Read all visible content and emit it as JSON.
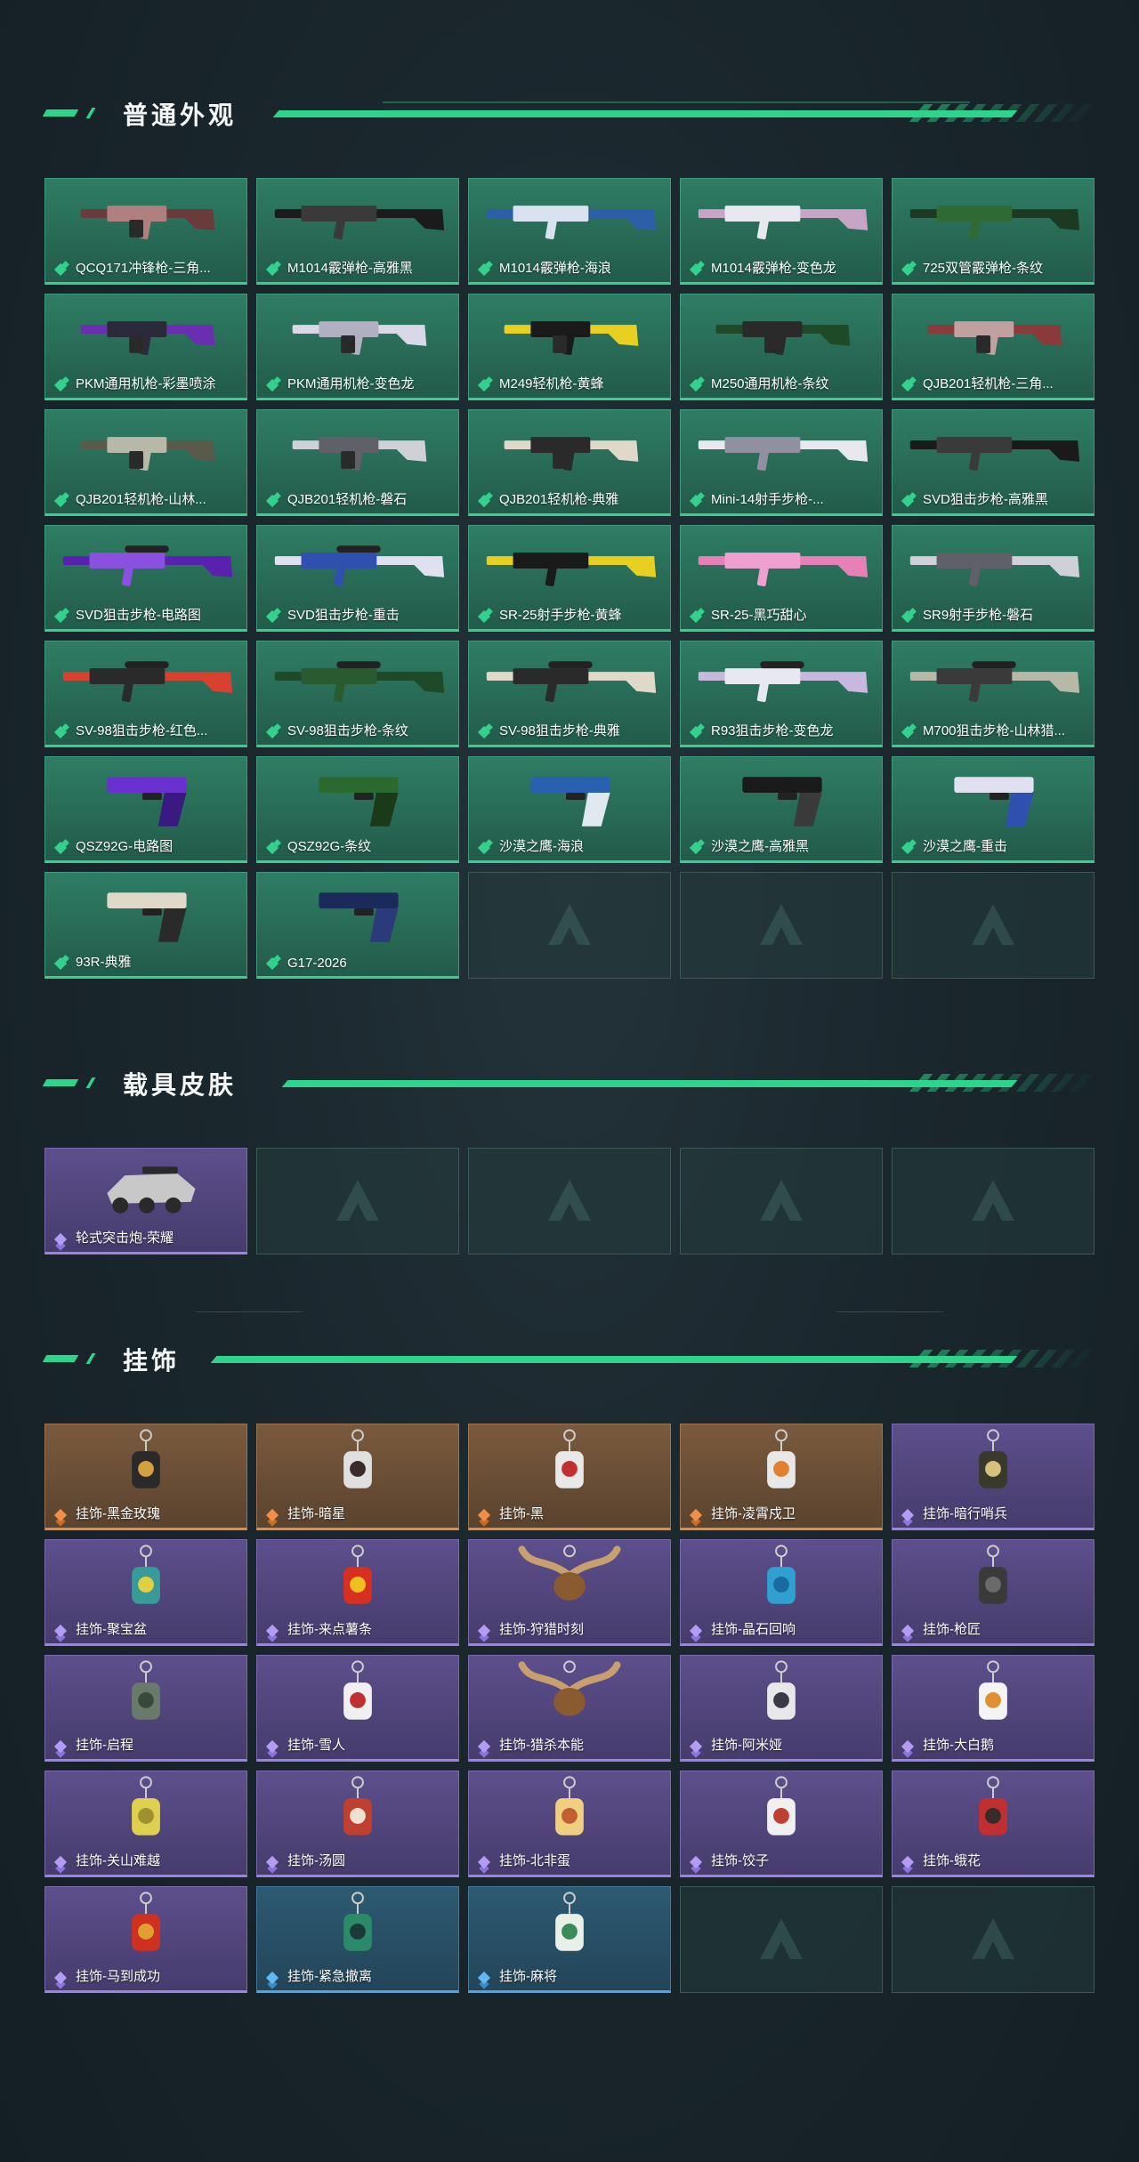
{
  "sections": {
    "appearance": {
      "title": "普通外观",
      "items": [
        {
          "label": "QCQ171冲锋枪-三角...",
          "rarity": "green",
          "icon": "smg-icon",
          "c1": "#6b3a3a",
          "c2": "#b08080"
        },
        {
          "label": "M1014霰弹枪-高雅黑",
          "rarity": "green",
          "icon": "shotgun-icon",
          "c1": "#1b1b1b",
          "c2": "#3a3a3a"
        },
        {
          "label": "M1014霰弹枪-海浪",
          "rarity": "green",
          "icon": "shotgun-icon",
          "c1": "#2c5fa8",
          "c2": "#d8e2f0"
        },
        {
          "label": "M1014霰弹枪-变色龙",
          "rarity": "green",
          "icon": "shotgun-icon",
          "c1": "#c8a5c6",
          "c2": "#e8e8f0"
        },
        {
          "label": "725双管霰弹枪-条纹",
          "rarity": "green",
          "icon": "shotgun-icon",
          "c1": "#1c3a22",
          "c2": "#2f6a35"
        },
        {
          "label": "PKM通用机枪-彩墨喷涂",
          "rarity": "green",
          "icon": "lmg-icon",
          "c1": "#6a2fb0",
          "c2": "#2a2a3a"
        },
        {
          "label": "PKM通用机枪-变色龙",
          "rarity": "green",
          "icon": "lmg-icon",
          "c1": "#d8d8e8",
          "c2": "#b0b0c0"
        },
        {
          "label": "M249轻机枪-黄蜂",
          "rarity": "green",
          "icon": "lmg-icon",
          "c1": "#e8d020",
          "c2": "#1a1a1a"
        },
        {
          "label": "M250通用机枪-条纹",
          "rarity": "green",
          "icon": "lmg-icon",
          "c1": "#1f4a28",
          "c2": "#2a2a2a"
        },
        {
          "label": "QJB201轻机枪-三角...",
          "rarity": "green",
          "icon": "lmg-icon",
          "c1": "#8a3a3a",
          "c2": "#c0a0a0"
        },
        {
          "label": "QJB201轻机枪-山林...",
          "rarity": "green",
          "icon": "lmg-icon",
          "c1": "#5a5a4a",
          "c2": "#b8b8a8"
        },
        {
          "label": "QJB201轻机枪-磐石",
          "rarity": "green",
          "icon": "lmg-icon",
          "c1": "#d0d0d8",
          "c2": "#606068"
        },
        {
          "label": "QJB201轻机枪-典雅",
          "rarity": "green",
          "icon": "lmg-icon",
          "c1": "#e0d8c8",
          "c2": "#2a2a2a"
        },
        {
          "label": "Mini-14射手步枪-...",
          "rarity": "green",
          "icon": "rifle-icon",
          "c1": "#e8e8f0",
          "c2": "#9090a0"
        },
        {
          "label": "SVD狙击步枪-高雅黑",
          "rarity": "green",
          "icon": "rifle-icon",
          "c1": "#1a1a1a",
          "c2": "#3a3a3a"
        },
        {
          "label": "SVD狙击步枪-电路图",
          "rarity": "green",
          "icon": "sniper-icon",
          "c1": "#5a20b0",
          "c2": "#8a50e0"
        },
        {
          "label": "SVD狙击步枪-重击",
          "rarity": "green",
          "icon": "sniper-icon",
          "c1": "#e0e0f0",
          "c2": "#3050b0"
        },
        {
          "label": "SR-25射手步枪-黄蜂",
          "rarity": "green",
          "icon": "rifle-icon",
          "c1": "#e8d020",
          "c2": "#1a1a1a"
        },
        {
          "label": "SR-25-黑巧甜心",
          "rarity": "green",
          "icon": "rifle-icon",
          "c1": "#e880b8",
          "c2": "#f0a0d0"
        },
        {
          "label": "SR9射手步枪-磐石",
          "rarity": "green",
          "icon": "rifle-icon",
          "c1": "#d0d0d8",
          "c2": "#606068"
        },
        {
          "label": "SV-98狙击步枪-红色...",
          "rarity": "green",
          "icon": "sniper-icon",
          "c1": "#d84030",
          "c2": "#2a2a2a"
        },
        {
          "label": "SV-98狙击步枪-条纹",
          "rarity": "green",
          "icon": "sniper-icon",
          "c1": "#1f4a28",
          "c2": "#2a5a30"
        },
        {
          "label": "SV-98狙击步枪-典雅",
          "rarity": "green",
          "icon": "sniper-icon",
          "c1": "#e0d8c8",
          "c2": "#2a2a2a"
        },
        {
          "label": "R93狙击步枪-变色龙",
          "rarity": "green",
          "icon": "sniper-icon",
          "c1": "#c8b8e0",
          "c2": "#e8e8f0"
        },
        {
          "label": "M700狙击步枪-山林猎...",
          "rarity": "green",
          "icon": "sniper-icon",
          "c1": "#b8b8a8",
          "c2": "#3a3a3a"
        },
        {
          "label": "QSZ92G-电路图",
          "rarity": "green",
          "icon": "pistol-icon",
          "c1": "#6a30d0",
          "c2": "#3a1a80"
        },
        {
          "label": "QSZ92G-条纹",
          "rarity": "green",
          "icon": "pistol-icon",
          "c1": "#2a6a30",
          "c2": "#1a3a1a"
        },
        {
          "label": "沙漠之鹰-海浪",
          "rarity": "green",
          "icon": "pistol-icon",
          "c1": "#2a60b0",
          "c2": "#e0e8f0"
        },
        {
          "label": "沙漠之鹰-高雅黑",
          "rarity": "green",
          "icon": "pistol-icon",
          "c1": "#1a1a1a",
          "c2": "#3a3a3a"
        },
        {
          "label": "沙漠之鹰-重击",
          "rarity": "green",
          "icon": "pistol-icon",
          "c1": "#e0e0f0",
          "c2": "#3050b0"
        },
        {
          "label": "93R-典雅",
          "rarity": "green",
          "icon": "pistol-icon",
          "c1": "#e0d8c8",
          "c2": "#2a2a2a"
        },
        {
          "label": "G17-2026",
          "rarity": "green",
          "icon": "pistol-icon",
          "c1": "#1a2a5a",
          "c2": "#2a3a7a"
        },
        {
          "label": "",
          "rarity": "empty"
        },
        {
          "label": "",
          "rarity": "empty"
        },
        {
          "label": "",
          "rarity": "empty"
        }
      ]
    },
    "vehicle": {
      "title": "载具皮肤",
      "items": [
        {
          "label": "轮式突击炮-荣耀",
          "rarity": "purple",
          "icon": "vehicle-icon",
          "c1": "#c8c8c8",
          "c2": "#2a2a2a"
        },
        {
          "label": "",
          "rarity": "empty"
        },
        {
          "label": "",
          "rarity": "empty"
        },
        {
          "label": "",
          "rarity": "empty"
        },
        {
          "label": "",
          "rarity": "empty"
        }
      ]
    },
    "charms": {
      "title": "挂饰",
      "items": [
        {
          "label": "挂饰-黑金玫瑰",
          "rarity": "orange",
          "icon": "charm-icon",
          "c1": "#2a2a2a",
          "c2": "#d4a040"
        },
        {
          "label": "挂饰-暗星",
          "rarity": "orange",
          "icon": "charm-icon",
          "c1": "#e0e0e0",
          "c2": "#3a2a2a"
        },
        {
          "label": "挂饰-黑",
          "rarity": "orange",
          "icon": "charm-icon",
          "c1": "#e8e8e8",
          "c2": "#c03030"
        },
        {
          "label": "挂饰-凌霄戍卫",
          "rarity": "orange",
          "icon": "charm-icon",
          "c1": "#e8e8e8",
          "c2": "#e08030"
        },
        {
          "label": "挂饰-暗行哨兵",
          "rarity": "purple",
          "icon": "charm-icon",
          "c1": "#3a3a2a",
          "c2": "#d8c080"
        },
        {
          "label": "挂饰-聚宝盆",
          "rarity": "purple",
          "icon": "charm-icon",
          "c1": "#3a9a9a",
          "c2": "#e0d040"
        },
        {
          "label": "挂饰-来点薯条",
          "rarity": "purple",
          "icon": "charm-icon",
          "c1": "#d83020",
          "c2": "#f0c020"
        },
        {
          "label": "挂饰-狩猎时刻",
          "rarity": "purple",
          "icon": "antler-icon",
          "c1": "#c8a070",
          "c2": "#8a5a30"
        },
        {
          "label": "挂饰-晶石回响",
          "rarity": "purple",
          "icon": "charm-icon",
          "c1": "#30a0d0",
          "c2": "#1a6aa0"
        },
        {
          "label": "挂饰-枪匠",
          "rarity": "purple",
          "icon": "charm-icon",
          "c1": "#3a3a3a",
          "c2": "#6a6a6a"
        },
        {
          "label": "挂饰-启程",
          "rarity": "purple",
          "icon": "charm-icon",
          "c1": "#6a7a6a",
          "c2": "#3a4a3a"
        },
        {
          "label": "挂饰-雪人",
          "rarity": "purple",
          "icon": "charm-icon",
          "c1": "#f0f0f0",
          "c2": "#c03030"
        },
        {
          "label": "挂饰-猎杀本能",
          "rarity": "purple",
          "icon": "antler-icon",
          "c1": "#c8a070",
          "c2": "#8a5a30"
        },
        {
          "label": "挂饰-阿米娅",
          "rarity": "purple",
          "icon": "charm-icon",
          "c1": "#e8e8e8",
          "c2": "#3a3a4a"
        },
        {
          "label": "挂饰-大白鹅",
          "rarity": "purple",
          "icon": "charm-icon",
          "c1": "#f4f4f4",
          "c2": "#e09030"
        },
        {
          "label": "挂饰-关山难越",
          "rarity": "purple",
          "icon": "charm-icon",
          "c1": "#e0d050",
          "c2": "#a09030"
        },
        {
          "label": "挂饰-汤圆",
          "rarity": "purple",
          "icon": "charm-icon",
          "c1": "#c04030",
          "c2": "#f0e0d0"
        },
        {
          "label": "挂饰-北非蛋",
          "rarity": "purple",
          "icon": "charm-icon",
          "c1": "#f0d080",
          "c2": "#c06030"
        },
        {
          "label": "挂饰-饺子",
          "rarity": "purple",
          "icon": "charm-icon",
          "c1": "#f0f0f0",
          "c2": "#c04030"
        },
        {
          "label": "挂饰-蛾花",
          "rarity": "purple",
          "icon": "charm-icon",
          "c1": "#c03030",
          "c2": "#3a2a2a"
        },
        {
          "label": "挂饰-马到成功",
          "rarity": "purple",
          "icon": "charm-icon",
          "c1": "#d03020",
          "c2": "#e0a030"
        },
        {
          "label": "挂饰-紧急撤离",
          "rarity": "blue",
          "icon": "charm-icon",
          "c1": "#2a8a6a",
          "c2": "#1a3a3a"
        },
        {
          "label": "挂饰-麻将",
          "rarity": "blue",
          "icon": "charm-icon",
          "c1": "#e8f0e8",
          "c2": "#3a8a5a"
        },
        {
          "label": "",
          "rarity": "empty"
        },
        {
          "label": "",
          "rarity": "empty"
        }
      ]
    }
  }
}
